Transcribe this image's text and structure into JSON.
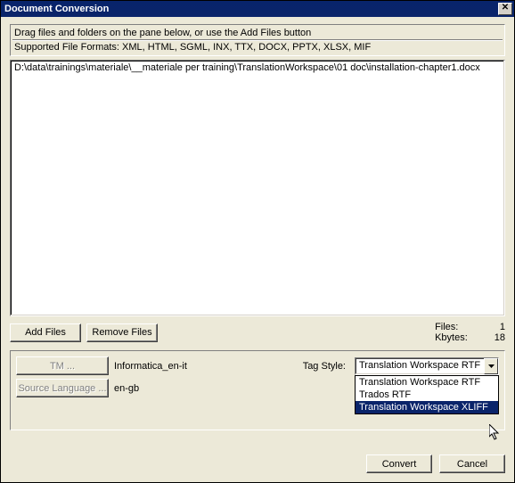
{
  "window": {
    "title": "Document Conversion",
    "close": "✕"
  },
  "info": {
    "drag_hint": "Drag files and folders on the pane below, or use the Add Files button",
    "formats_label": "Supported File Formats:  XML, HTML, SGML, INX, TTX, DOCX, PPTX, XLSX, MIF"
  },
  "files": {
    "items": [
      "D:\\data\\trainings\\materiale\\__materiale per training\\TranslationWorkspace\\01 doc\\installation-chapter1.docx"
    ]
  },
  "buttons": {
    "add_files": "Add Files",
    "remove_files": "Remove Files",
    "tm": "TM ...",
    "source_language": "Source Language ...",
    "convert": "Convert",
    "cancel": "Cancel"
  },
  "stats": {
    "files_label": "Files:",
    "files_value": "1",
    "kbytes_label": "Kbytes:",
    "kbytes_value": "18"
  },
  "labels": {
    "tm_value": "Informatica_en-it",
    "source_lang_value": "en-gb",
    "tag_style": "Tag Style:"
  },
  "tag_style": {
    "selected": "Translation Workspace RTF",
    "options": [
      {
        "label": "Translation Workspace RTF",
        "selected": false
      },
      {
        "label": "Trados RTF",
        "selected": false
      },
      {
        "label": "Translation Workspace XLIFF",
        "selected": true
      }
    ]
  }
}
